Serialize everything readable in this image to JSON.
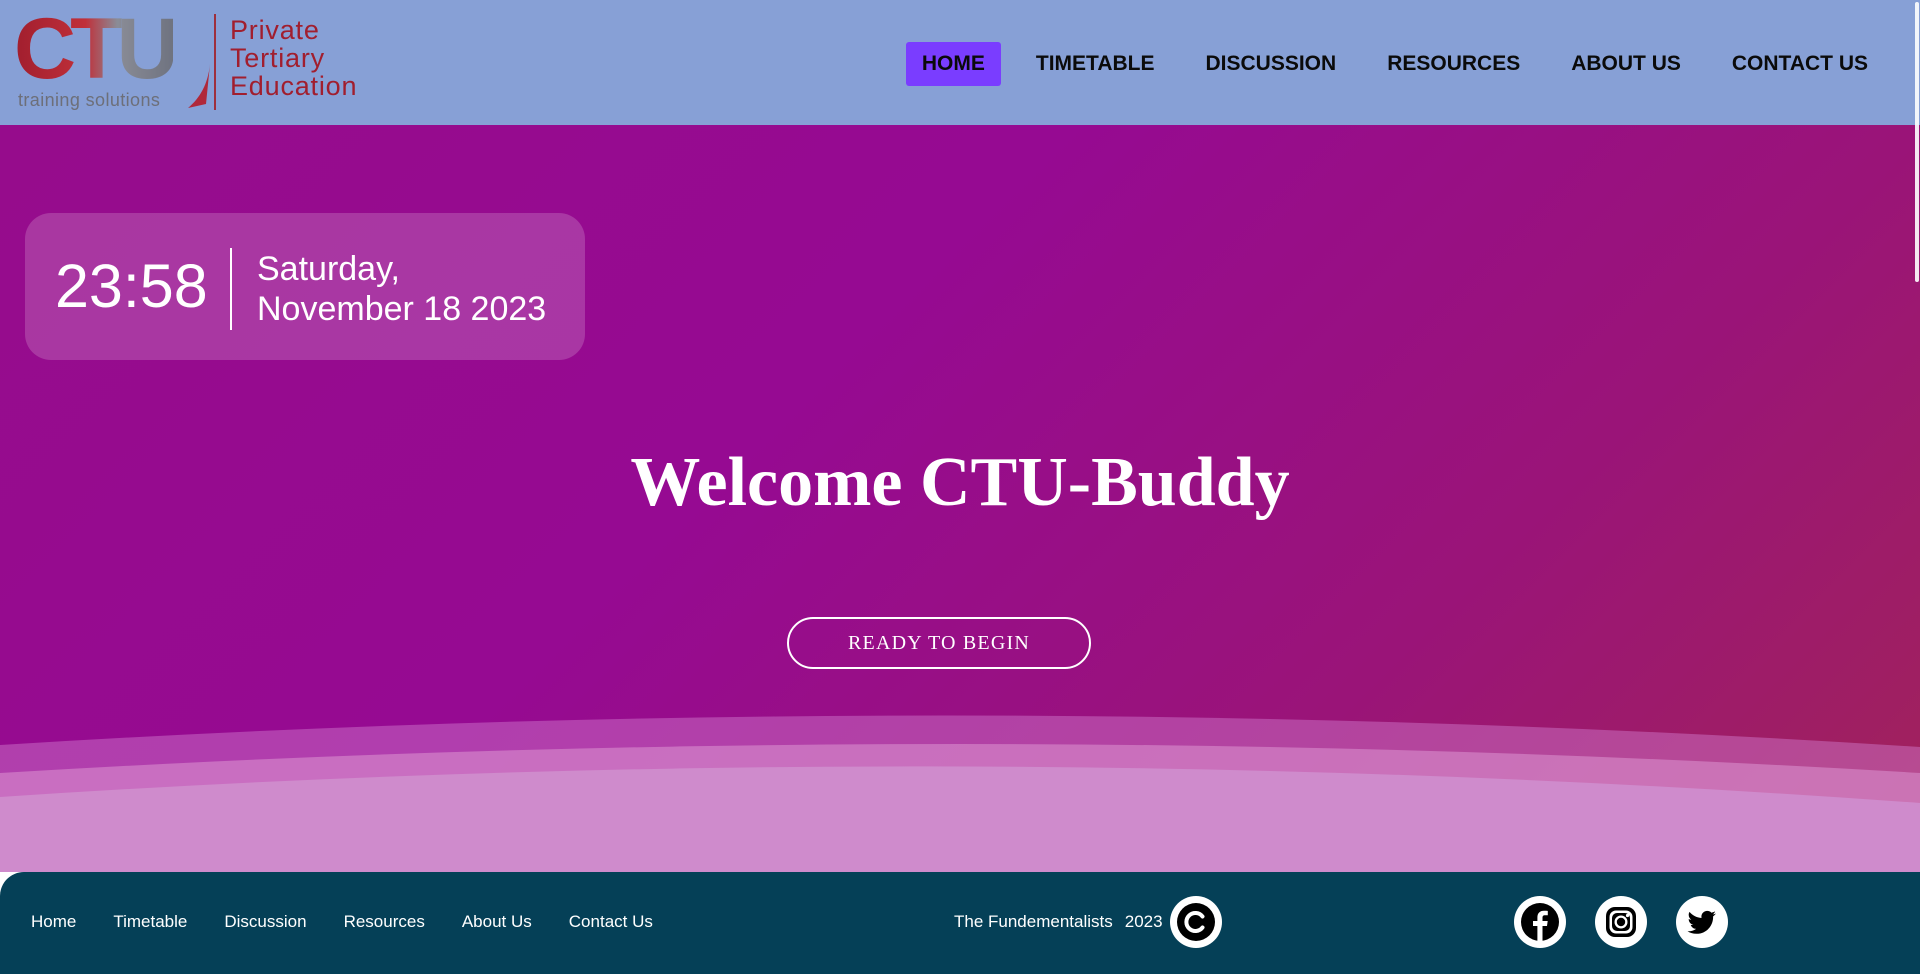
{
  "brand": {
    "logo_letters": "CTU",
    "tagline": "training solutions",
    "descriptor": [
      "Private",
      "Tertiary",
      "Education"
    ],
    "red": "#a11e2e",
    "grey": "#6f7380"
  },
  "nav": {
    "items": [
      {
        "label": "HOME",
        "active": true
      },
      {
        "label": "TIMETABLE",
        "active": false
      },
      {
        "label": "DISCUSSION",
        "active": false
      },
      {
        "label": "RESOURCES",
        "active": false
      },
      {
        "label": "ABOUT US",
        "active": false
      },
      {
        "label": "CONTACT US",
        "active": false
      }
    ],
    "active_color": "#7a3dff",
    "bar_color": "#87a0d6"
  },
  "hero": {
    "time": "23:58",
    "date_line1": "Saturday,",
    "date_line2": "November 18 2023",
    "heading": "Welcome CTU-Buddy",
    "cta_label": "READY TO BEGIN",
    "gradient_start": "#960c8c",
    "gradient_end": "#a1235a"
  },
  "footer": {
    "links": [
      "Home",
      "Timetable",
      "Discussion",
      "Resources",
      "About Us",
      "Contact Us"
    ],
    "credit_name": "The Fundementalists",
    "credit_year": "2023",
    "copyright_icon": "copyright-icon",
    "social": [
      "facebook-icon",
      "instagram-icon",
      "twitter-icon"
    ],
    "background": "#054057"
  }
}
